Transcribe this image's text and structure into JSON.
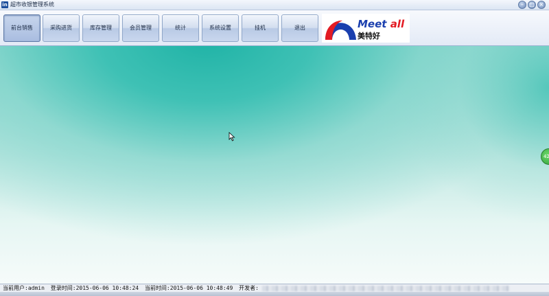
{
  "window": {
    "title": "超市收银管理系统",
    "icon": "app-logo-icon",
    "controls": {
      "minimize_symbol": "–",
      "maximize_symbol": "□",
      "close_symbol": "×"
    }
  },
  "toolbar": {
    "buttons": [
      {
        "label": "前台销售",
        "active": true
      },
      {
        "label": "采购进货",
        "active": false
      },
      {
        "label": "库存管理",
        "active": false
      },
      {
        "label": "会员管理",
        "active": false
      },
      {
        "label": "统计",
        "active": false
      },
      {
        "label": "系统设置",
        "active": false
      },
      {
        "label": "挂机",
        "active": false
      },
      {
        "label": "退出",
        "active": false
      }
    ],
    "logo": {
      "text_en_part1": "Meet",
      "text_en_part2": "all",
      "text_cn": "美特好"
    }
  },
  "main": {
    "side_badge": "42"
  },
  "status": {
    "user_label": "当前用户:",
    "user": "admin",
    "login_label": "登录时间:",
    "login_time": "2015-06-06 10:48:24",
    "current_label": "当前时间:",
    "current_time": "2015-06-06 10:48:49",
    "developer_label": "开发者:"
  },
  "colors": {
    "accent": "#1fb3a6",
    "logo_blue": "#1a3fae",
    "logo_red": "#e31b23"
  }
}
